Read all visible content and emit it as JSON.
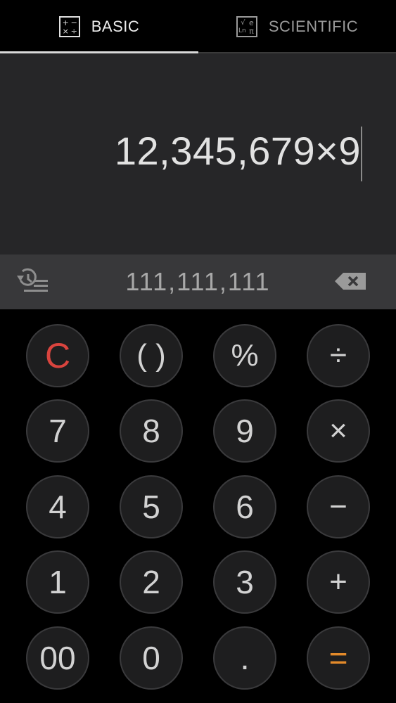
{
  "tabs": {
    "basic": {
      "label": "BASIC",
      "icon_glyphs": [
        "+",
        "−",
        "×",
        "÷"
      ]
    },
    "scientific": {
      "label": "SCIENTIFIC",
      "icon_glyphs": [
        "√",
        "e",
        "Ln",
        "π"
      ]
    }
  },
  "display": {
    "expression": "12,345,679×9"
  },
  "result_bar": {
    "history_icon": "history-icon",
    "result": "111,111,111",
    "backspace_icon": "backspace-icon"
  },
  "keypad": {
    "rows": [
      [
        "C",
        "( )",
        "%",
        "÷"
      ],
      [
        "7",
        "8",
        "9",
        "×"
      ],
      [
        "4",
        "5",
        "6",
        "−"
      ],
      [
        "1",
        "2",
        "3",
        "+"
      ],
      [
        "00",
        "0",
        ".",
        "="
      ]
    ]
  },
  "colors": {
    "clear_key": "#d9443e",
    "equals_key": "#e38a2a",
    "display_bg": "#262628",
    "result_bar_bg": "#38383a"
  }
}
